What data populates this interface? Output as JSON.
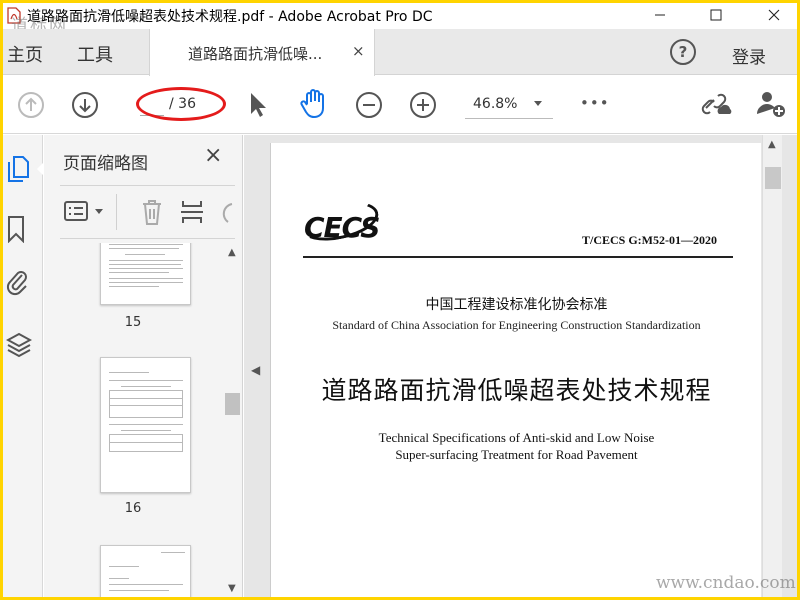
{
  "window": {
    "title": "道路路面抗滑低噪超表处技术规程.pdf - Adobe Acrobat Pro DC",
    "minimize_icon": "minimize-icon",
    "maximize_icon": "maximize-icon",
    "close_icon": "close-icon"
  },
  "watermark": {
    "top_left": "道标网",
    "bottom_right": "www.cndao.com"
  },
  "tabs": {
    "home": "主页",
    "tools": "工具",
    "document": "道路路面抗滑低噪...",
    "document_close": "×",
    "help": "?",
    "login": "登录"
  },
  "toolbar": {
    "page_current": "",
    "page_total": "/ 36",
    "zoom": "46.8%",
    "more": "•••",
    "highlight_color": "#e41b1b",
    "hand_tool_color": "#1473e6"
  },
  "thumbnails": {
    "title": "页面缩略图",
    "close": "×",
    "pages": [
      "15",
      "16"
    ]
  },
  "page": {
    "logo": "CECS",
    "code": "T/CECS G:M52-01—2020",
    "org_cn": "中国工程建设标准化协会标准",
    "org_en": "Standard of China Association for Engineering Construction Standardization",
    "title_cn": "道路路面抗滑低噪超表处技术规程",
    "title_en_line1": "Technical Specifications of Anti-skid and Low Noise",
    "title_en_line2": "Super-surfacing Treatment for Road Pavement"
  }
}
